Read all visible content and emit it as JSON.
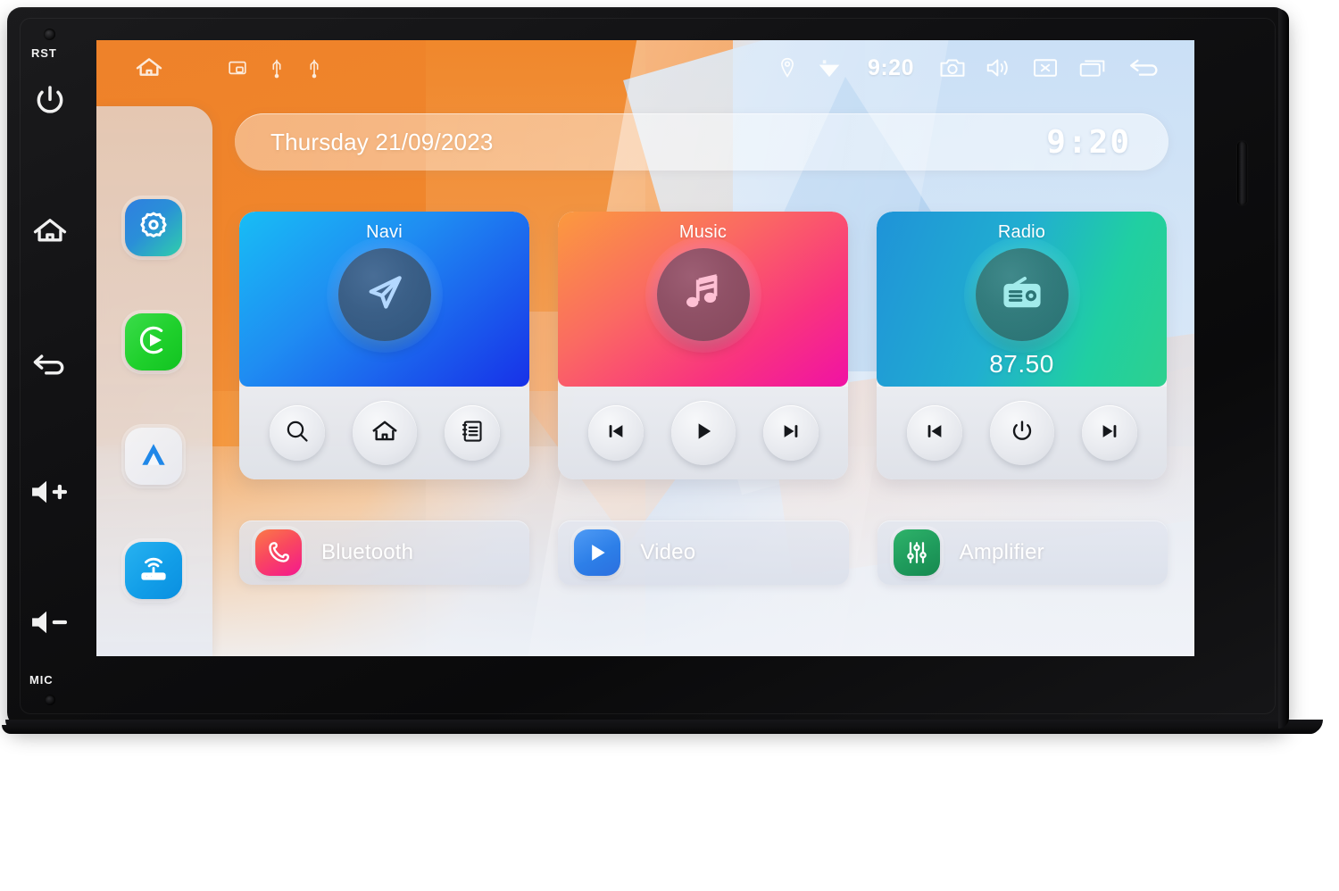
{
  "device": {
    "labels": {
      "reset": "RST",
      "mic": "MIC"
    },
    "buttons": [
      {
        "name": "power-button",
        "icon": "power-icon"
      },
      {
        "name": "home-button",
        "icon": "home-icon"
      },
      {
        "name": "back-button",
        "icon": "back-arrow-icon"
      },
      {
        "name": "volume-up-button",
        "icon": "volume-up-icon"
      },
      {
        "name": "volume-down-button",
        "icon": "volume-down-icon"
      }
    ]
  },
  "statusbar": {
    "left_icons": [
      {
        "name": "home-icon",
        "label": "home-icon"
      },
      {
        "name": "screen-cast-icon",
        "label": "screen-cast-icon"
      },
      {
        "name": "usb-icon-1",
        "label": "usb-icon"
      },
      {
        "name": "usb-icon-2",
        "label": "usb-icon"
      }
    ],
    "right_icons": [
      {
        "name": "location-pin-icon",
        "label": "location-pin-icon"
      },
      {
        "name": "wifi-icon",
        "label": "wifi-icon"
      },
      {
        "name": "camera-icon",
        "label": "camera-icon"
      },
      {
        "name": "volume-icon",
        "label": "volume-icon"
      },
      {
        "name": "close-box-icon",
        "label": "close-box-icon"
      },
      {
        "name": "recent-apps-icon",
        "label": "recent-apps-icon"
      },
      {
        "name": "back-arrow-icon",
        "label": "back-arrow-icon"
      }
    ],
    "time": "9:20"
  },
  "sidebar": {
    "items": [
      {
        "label": "settings",
        "icon": "gear-icon"
      },
      {
        "label": "carplay",
        "icon": "play-circle-icon"
      },
      {
        "label": "android-auto",
        "icon": "android-auto-chevron-icon"
      },
      {
        "label": "wifi-router",
        "icon": "router-icon"
      }
    ]
  },
  "datebar": {
    "date": "Thursday 21/09/2023",
    "clock": "9:20"
  },
  "cards": [
    {
      "title": "Navi",
      "icon": "navigation-arrow-icon",
      "value": "",
      "controls": [
        {
          "label": "search",
          "icon": "search-icon"
        },
        {
          "label": "home",
          "icon": "home-icon"
        },
        {
          "label": "list",
          "icon": "notebook-list-icon"
        }
      ]
    },
    {
      "title": "Music",
      "icon": "music-note-icon",
      "value": "",
      "controls": [
        {
          "label": "previous",
          "icon": "skip-previous-icon"
        },
        {
          "label": "play",
          "icon": "play-icon"
        },
        {
          "label": "next",
          "icon": "skip-next-icon"
        }
      ]
    },
    {
      "title": "Radio",
      "icon": "radio-icon",
      "value": "87.50",
      "controls": [
        {
          "label": "previous",
          "icon": "skip-previous-icon"
        },
        {
          "label": "power",
          "icon": "power-icon"
        },
        {
          "label": "next",
          "icon": "skip-next-icon"
        }
      ]
    }
  ],
  "shortcuts": [
    {
      "label": "Bluetooth",
      "icon": "phone-handset-icon"
    },
    {
      "label": "Video",
      "icon": "play-icon"
    },
    {
      "label": "Amplifier",
      "icon": "equalizer-icon"
    }
  ],
  "colors": {
    "navi": "#1f8df2",
    "music": "#f9337f",
    "radio": "#20cfa2",
    "bluetooth": "#f4178f",
    "video": "#2d7fe8",
    "amplifier": "#1f9b5c",
    "wallpaper_orange": "#f08a33",
    "wallpaper_blue": "#b9d2ef"
  }
}
